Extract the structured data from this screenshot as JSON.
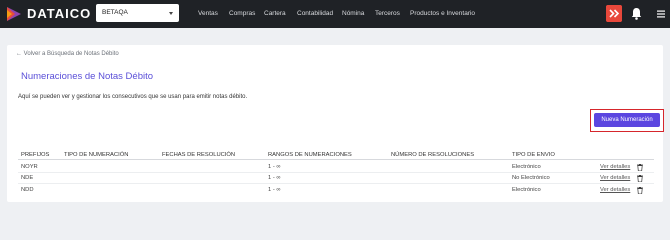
{
  "header": {
    "brand": "DATAICO",
    "company_select": "BETAQA",
    "nav": [
      "Ventas",
      "Compras",
      "Cartera",
      "Contabilidad",
      "Nómina",
      "Terceros",
      "Productos e Inventario"
    ]
  },
  "page": {
    "back_link": "← Volver a Búsqueda de Notas Débito",
    "title": "Numeraciones de Notas Débito",
    "description": "Aquí se pueden ver y gestionar los consecutivos que se usan para emitir notas débito.",
    "new_button": "Nueva Numeración"
  },
  "table": {
    "columns": [
      "PREFIJOS",
      "TIPO DE NUMERACIÓN",
      "FECHAS DE RESOLUCIÓN",
      "RANGOS DE NUMERACIONES",
      "NÚMERO DE RESOLUCIONES",
      "TIPO DE ENVIO"
    ],
    "rows": [
      {
        "prefix": "NOYR",
        "type": "",
        "dates": "",
        "range": "1 - ∞",
        "resolution": "",
        "send_type": "Electrónico",
        "action": "Ver detalles"
      },
      {
        "prefix": "NDE",
        "type": "",
        "dates": "",
        "range": "1 - ∞",
        "resolution": "",
        "send_type": "No Electrónico",
        "action": "Ver detalles"
      },
      {
        "prefix": "NDD",
        "type": "",
        "dates": "",
        "range": "1 - ∞",
        "resolution": "",
        "send_type": "Electrónico",
        "action": "Ver detalles"
      }
    ]
  },
  "colors": {
    "topbar": "#1f2226",
    "accent": "#5b46e0",
    "title": "#5a4fd8",
    "highlight": "#d6262c",
    "app_switch": "#e8483b"
  },
  "icons": [
    "dataico-logo-icon",
    "chevron-down-icon",
    "app-switch-icon",
    "bell-icon",
    "hamburger-menu-icon",
    "trash-icon"
  ]
}
